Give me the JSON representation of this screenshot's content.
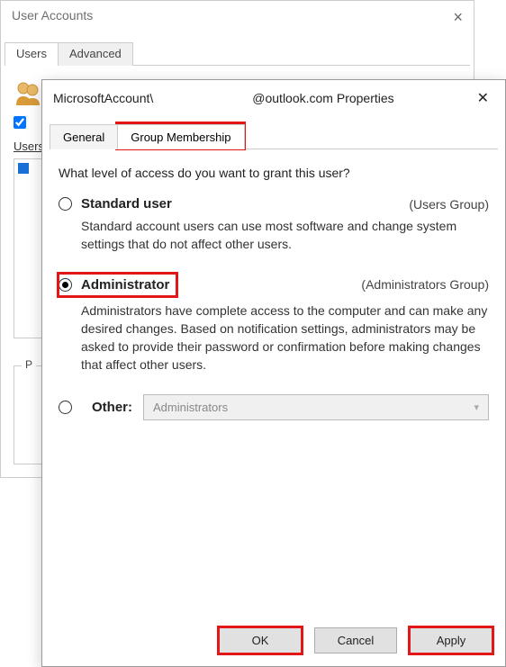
{
  "bg": {
    "title": "User Accounts",
    "tabs": {
      "users": "Users",
      "advanced": "Advanced"
    },
    "users_label": "Users for this computer:",
    "pwd_label": "Password for"
  },
  "props": {
    "title_prefix": "MicrosoftAccount\\",
    "title_suffix": "@outlook.com Properties",
    "tabs": {
      "general": "General",
      "group": "Group Membership"
    },
    "question": "What level of access do you want to grant this user?",
    "standard": {
      "label": "Standard user",
      "group": "(Users Group)",
      "desc": "Standard account users can use most software and change system settings that do not affect other users."
    },
    "admin": {
      "label": "Administrator",
      "group": "(Administrators Group)",
      "desc": "Administrators have complete access to the computer and can make any desired changes. Based on notification settings, administrators may be asked to provide their password or confirmation before making changes that affect other users."
    },
    "other": {
      "label": "Other:",
      "selected": "Administrators"
    },
    "buttons": {
      "ok": "OK",
      "cancel": "Cancel",
      "apply": "Apply"
    }
  }
}
